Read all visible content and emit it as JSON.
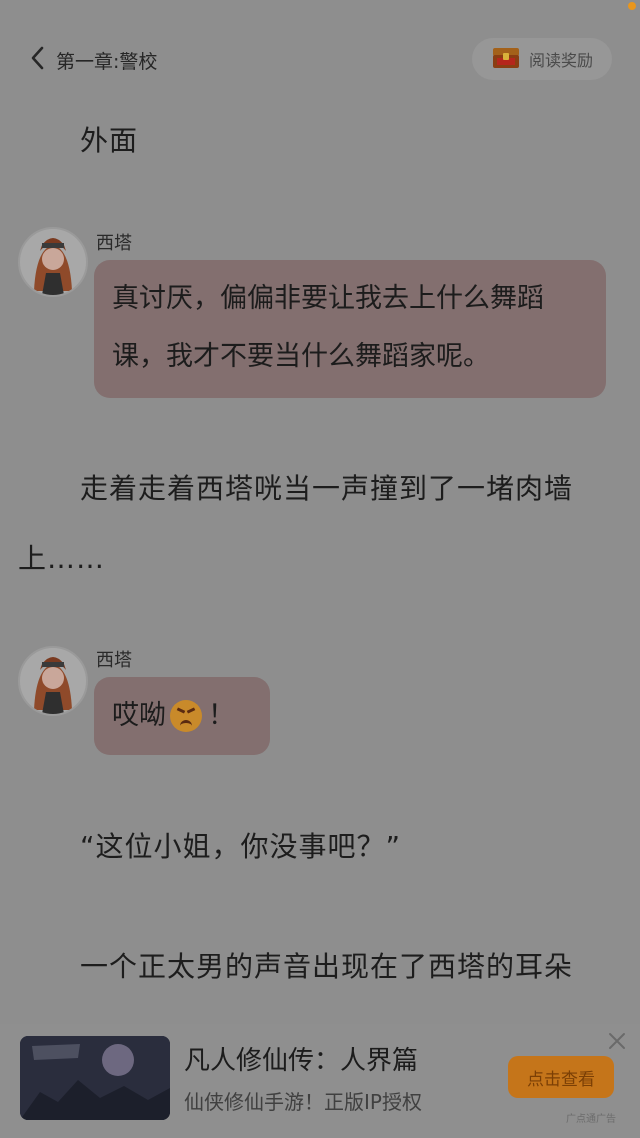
{
  "header": {
    "chapter_title": "第一章:警校",
    "reward_label": "阅读奖励"
  },
  "content": {
    "para_outside": "外面",
    "messages": [
      {
        "speaker": "西塔",
        "text": "真讨厌，偏偏非要让我去上什么舞蹈课，我才不要当什么舞蹈家呢。"
      },
      {
        "speaker": "西塔",
        "text_before": "哎呦",
        "emoji": "persevering-face-icon",
        "text_after": "！"
      }
    ],
    "para_walk": "走着走着西塔咣当一声撞到了一堵肉墙上……",
    "para_quote": "“这位小姐，你没事吧？”",
    "para_voice": "一个正太男的声音出现在了西塔的耳朵"
  },
  "ad": {
    "title": "凡人修仙传：人界篇",
    "description": "仙侠修仙手游！正版IP授权",
    "cta_label": "点击查看",
    "source_label": "广点通广告"
  },
  "colors": {
    "overlay_background": "#8e8e8e",
    "bubble": "#836f6f",
    "cta": "#c5751a",
    "status_dot": "#e9961d"
  }
}
